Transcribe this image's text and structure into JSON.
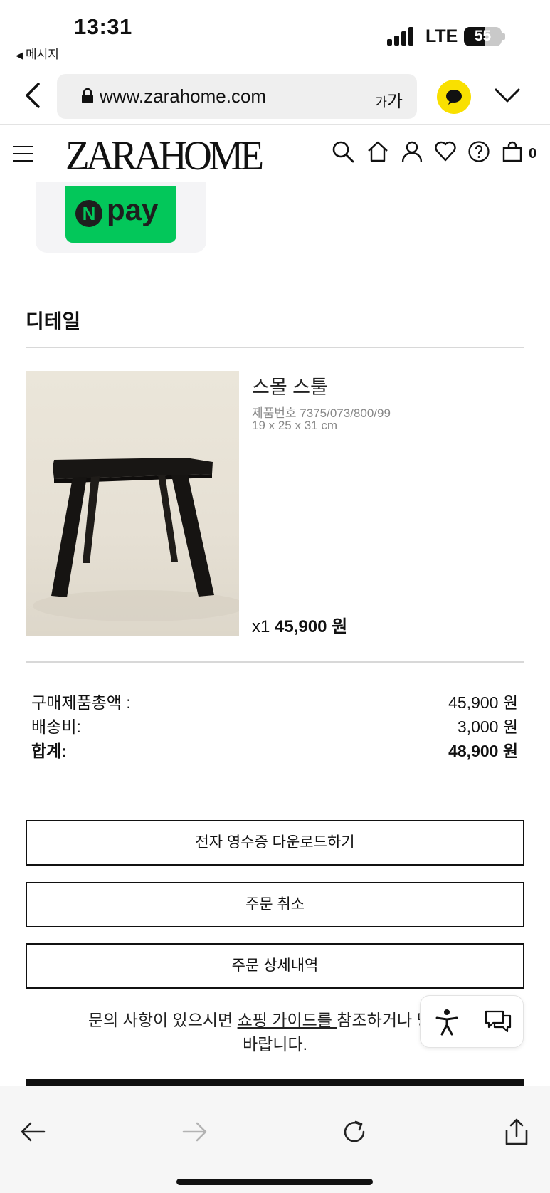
{
  "status_bar": {
    "time": "13:31",
    "back_app": "메시지",
    "network": "LTE",
    "battery": "55",
    "battery_level": 0.55
  },
  "browser": {
    "url": "www.zarahome.com",
    "text_size_small": "가",
    "text_size_large": "가",
    "accent_kakao": "#f9e000"
  },
  "header": {
    "logo": "ZARAHOME",
    "cart_count": "0"
  },
  "payment": {
    "npay_n": "N",
    "npay_label": "pay",
    "brand_color": "#03c75a"
  },
  "details": {
    "title": "디테일",
    "product": {
      "name": "스몰 스툴",
      "ref": "제품번호 7375/073/800/99",
      "dimensions": "19 x 25 x 31 cm",
      "quantity": "x1",
      "price": "45,900 원"
    }
  },
  "totals": {
    "subtotal_label": "구매제품총액 :",
    "subtotal_value": "45,900 원",
    "shipping_label": "배송비:",
    "shipping_value": "3,000 원",
    "total_label": "합계:",
    "total_value": "48,900 원"
  },
  "actions": {
    "receipt": "전자 영수증 다운로드하기",
    "cancel": "주문 취소",
    "details": "주문 상세내역"
  },
  "help": {
    "line1_prefix": "문의 사항이 있으시면 ",
    "link": "쇼핑 가이드를 ",
    "line1_suffix": "참조하거나 당사로",
    "line2": "바랍니다."
  }
}
